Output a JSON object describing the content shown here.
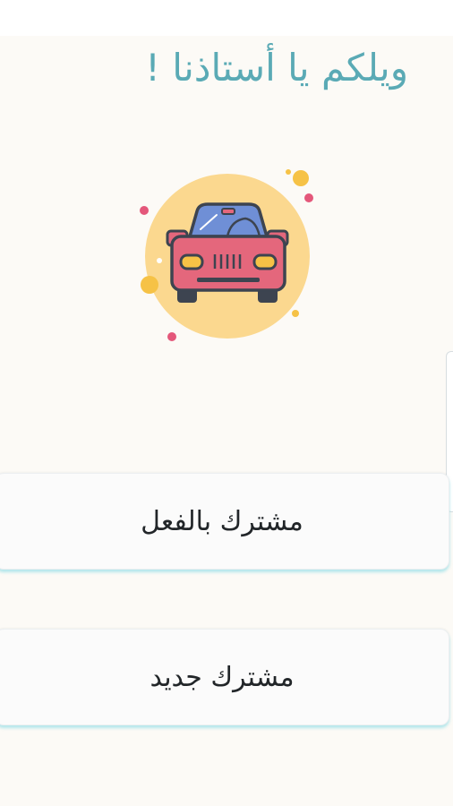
{
  "header": {
    "title": "ويلكم يا أستاذنا !"
  },
  "illustration": {
    "icon": "car-icon"
  },
  "buttons": {
    "existing_subscriber": "مشترك بالفعل",
    "new_subscriber": "مشترك جديد"
  },
  "colors": {
    "title": "#5aaab5",
    "background": "#fcfaf6",
    "button_glow": "#78d7e1",
    "car_body": "#e4677c",
    "car_window": "#6f8fd6",
    "circle": "#fbd88f",
    "dots_yellow": "#f6c246",
    "dots_pink": "#e4577a"
  }
}
